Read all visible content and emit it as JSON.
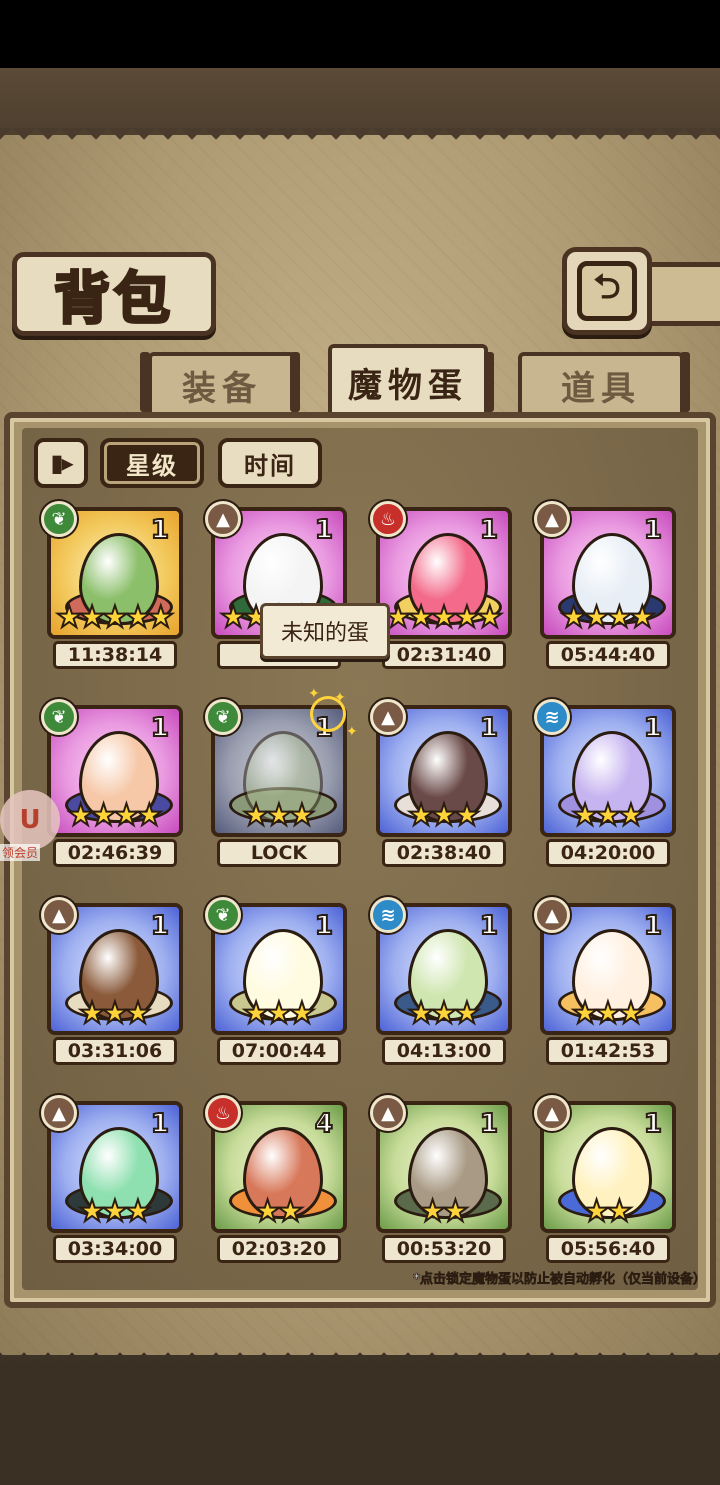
{
  "title": "背包",
  "back_icon": "back-arrow-icon",
  "tabs": [
    {
      "label": "装备",
      "active": false
    },
    {
      "label": "魔物蛋",
      "active": true
    },
    {
      "label": "道具",
      "active": false
    }
  ],
  "filters": {
    "pause_icon": "pause-icon",
    "sort_star": "星级",
    "sort_time": "时间"
  },
  "tooltip": "未知的蛋",
  "vip_badge": {
    "label": "领会员"
  },
  "footnote": "*点击锁定魔物蛋以防止被自动孵化（仅当前设备）",
  "eggs": [
    {
      "element": "grass",
      "frame": "gold",
      "count": "1",
      "stars": 5,
      "timer": "11:38:14",
      "egg_color": "#8bbf6a",
      "nest_color": "#d06a5a"
    },
    {
      "element": "rock",
      "frame": "pink",
      "count": "1",
      "stars": 5,
      "timer": "04",
      "egg_color": "#f4f4f4",
      "nest_color": "#2f6a3a"
    },
    {
      "element": "fire",
      "frame": "pink",
      "count": "1",
      "stars": 5,
      "timer": "02:31:40",
      "egg_color": "#f36a8a",
      "nest_color": "#f2d060"
    },
    {
      "element": "rock",
      "frame": "pink",
      "count": "1",
      "stars": 4,
      "timer": "05:44:40",
      "egg_color": "#e8eef6",
      "nest_color": "#2a3a70"
    },
    {
      "element": "grass",
      "frame": "pink",
      "count": "1",
      "stars": 4,
      "timer": "02:46:39",
      "egg_color": "#f6c8a8",
      "nest_color": "#4a4aa0"
    },
    {
      "element": "grass",
      "frame": "blue",
      "count": "1",
      "stars": 3,
      "timer": "LOCK",
      "egg_color": "#a8b890",
      "nest_color": "#8a9a78",
      "locked": true
    },
    {
      "element": "rock",
      "frame": "blue",
      "count": "1",
      "stars": 3,
      "timer": "02:38:40",
      "egg_color": "#6a4a48",
      "nest_color": "#e8e0d8"
    },
    {
      "element": "water",
      "frame": "blue",
      "count": "1",
      "stars": 3,
      "timer": "04:20:00",
      "egg_color": "#c6b4f0",
      "nest_color": "#a090e0"
    },
    {
      "element": "rock",
      "frame": "blue",
      "count": "1",
      "stars": 3,
      "timer": "03:31:06",
      "egg_color": "#8a5a3a",
      "nest_color": "#e8dcc0"
    },
    {
      "element": "grass",
      "frame": "blue",
      "count": "1",
      "stars": 3,
      "timer": "07:00:44",
      "egg_color": "#fffbe0",
      "nest_color": "#c8c890"
    },
    {
      "element": "water",
      "frame": "blue",
      "count": "1",
      "stars": 3,
      "timer": "04:13:00",
      "egg_color": "#cfe6b0",
      "nest_color": "#3a5a8a"
    },
    {
      "element": "rock",
      "frame": "blue",
      "count": "1",
      "stars": 3,
      "timer": "01:42:53",
      "egg_color": "#fff0e0",
      "nest_color": "#f6c060"
    },
    {
      "element": "rock",
      "frame": "blue",
      "count": "1",
      "stars": 3,
      "timer": "03:34:00",
      "egg_color": "#8fe0b0",
      "nest_color": "#2e3a3a"
    },
    {
      "element": "fire",
      "frame": "green",
      "count": "4",
      "stars": 2,
      "timer": "02:03:20",
      "egg_color": "#d8785a",
      "nest_color": "#f0903a"
    },
    {
      "element": "rock",
      "frame": "green",
      "count": "1",
      "stars": 2,
      "timer": "00:53:20",
      "egg_color": "#a89a84",
      "nest_color": "#5a6a4a"
    },
    {
      "element": "rock",
      "frame": "green",
      "count": "1",
      "stars": 2,
      "timer": "05:56:40",
      "egg_color": "#fff2c0",
      "nest_color": "#4a6ad8"
    }
  ]
}
